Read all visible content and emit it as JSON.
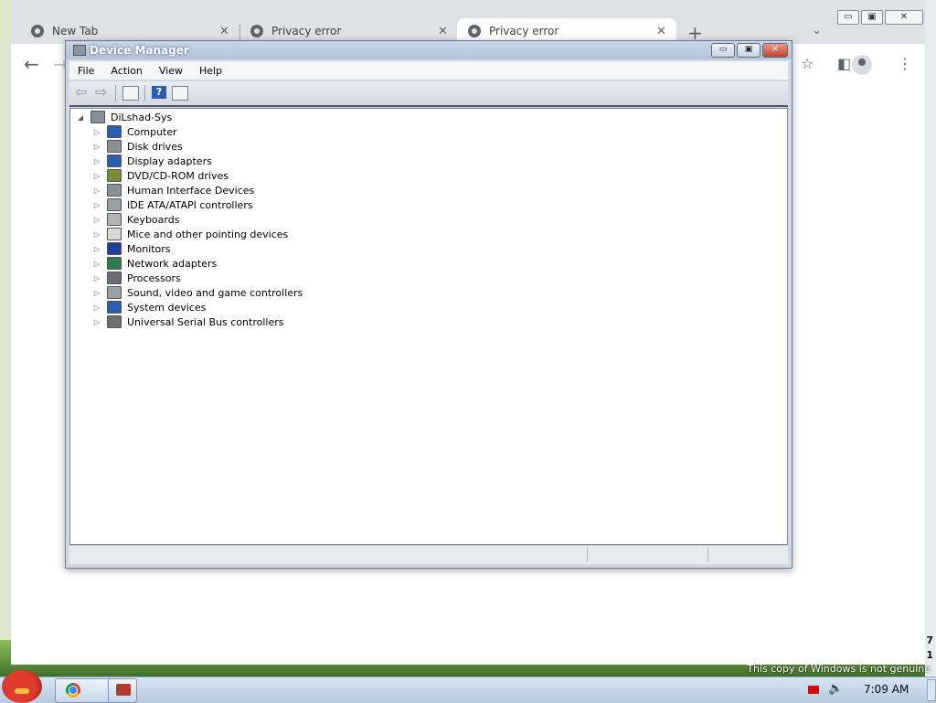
{
  "browser": {
    "tabs": [
      {
        "label": "New Tab",
        "active": false
      },
      {
        "label": "Privacy error",
        "active": false
      },
      {
        "label": "Privacy error",
        "active": true
      }
    ],
    "tab_close_glyph": "✕",
    "new_tab_glyph": "+",
    "tab_search_glyph": "⌄",
    "nav": {
      "back_glyph": "←",
      "forward_glyph": "→"
    },
    "toolbar_icons": {
      "star": "☆",
      "sidepanel": "◧",
      "menu": "⋮"
    },
    "window_buttons": {
      "minimize": "▭",
      "maximize": "▣",
      "close": "✕"
    }
  },
  "device_manager": {
    "title": "Device Manager",
    "window_buttons": {
      "minimize": "▭",
      "maximize": "▣",
      "close": "✕"
    },
    "menu": [
      "File",
      "Action",
      "View",
      "Help"
    ],
    "toolbar": {
      "back_glyph": "⇦",
      "forward_glyph": "⇨",
      "help_glyph": "?"
    },
    "root": {
      "label": "DiLshad-Sys",
      "expander": "◢"
    },
    "collapsed_glyph": "▷",
    "categories": [
      {
        "label": "Computer",
        "icon": "computer-icon",
        "color": "#2a5db0"
      },
      {
        "label": "Disk drives",
        "icon": "disk-drive-icon",
        "color": "#8a8f95"
      },
      {
        "label": "Display adapters",
        "icon": "display-adapter-icon",
        "color": "#2a5db0"
      },
      {
        "label": "DVD/CD-ROM drives",
        "icon": "dvd-drive-icon",
        "color": "#7b8c3a"
      },
      {
        "label": "Human Interface Devices",
        "icon": "hid-icon",
        "color": "#8a8f95"
      },
      {
        "label": "IDE ATA/ATAPI controllers",
        "icon": "ide-controller-icon",
        "color": "#9aa0a6"
      },
      {
        "label": "Keyboards",
        "icon": "keyboard-icon",
        "color": "#b0b4b8"
      },
      {
        "label": "Mice and other pointing devices",
        "icon": "mouse-icon",
        "color": "#d8d8d8"
      },
      {
        "label": "Monitors",
        "icon": "monitor-icon",
        "color": "#1e3f9a"
      },
      {
        "label": "Network adapters",
        "icon": "network-adapter-icon",
        "color": "#2f7a4a"
      },
      {
        "label": "Processors",
        "icon": "processor-icon",
        "color": "#6b6f73"
      },
      {
        "label": "Sound, video and game controllers",
        "icon": "speaker-icon",
        "color": "#9aa0a6"
      },
      {
        "label": "System devices",
        "icon": "system-devices-icon",
        "color": "#2a5db0"
      },
      {
        "label": "Universal Serial Bus controllers",
        "icon": "usb-icon",
        "color": "#6b6f73"
      }
    ]
  },
  "desktop": {
    "genuine_notice": "This copy of Windows is not genuine",
    "side_digits": [
      "7",
      "1"
    ]
  },
  "taskbar": {
    "clock": "7:09 AM",
    "apps": [
      "chrome-icon",
      "device-manager-icon"
    ],
    "volume_glyph": "🔈"
  }
}
